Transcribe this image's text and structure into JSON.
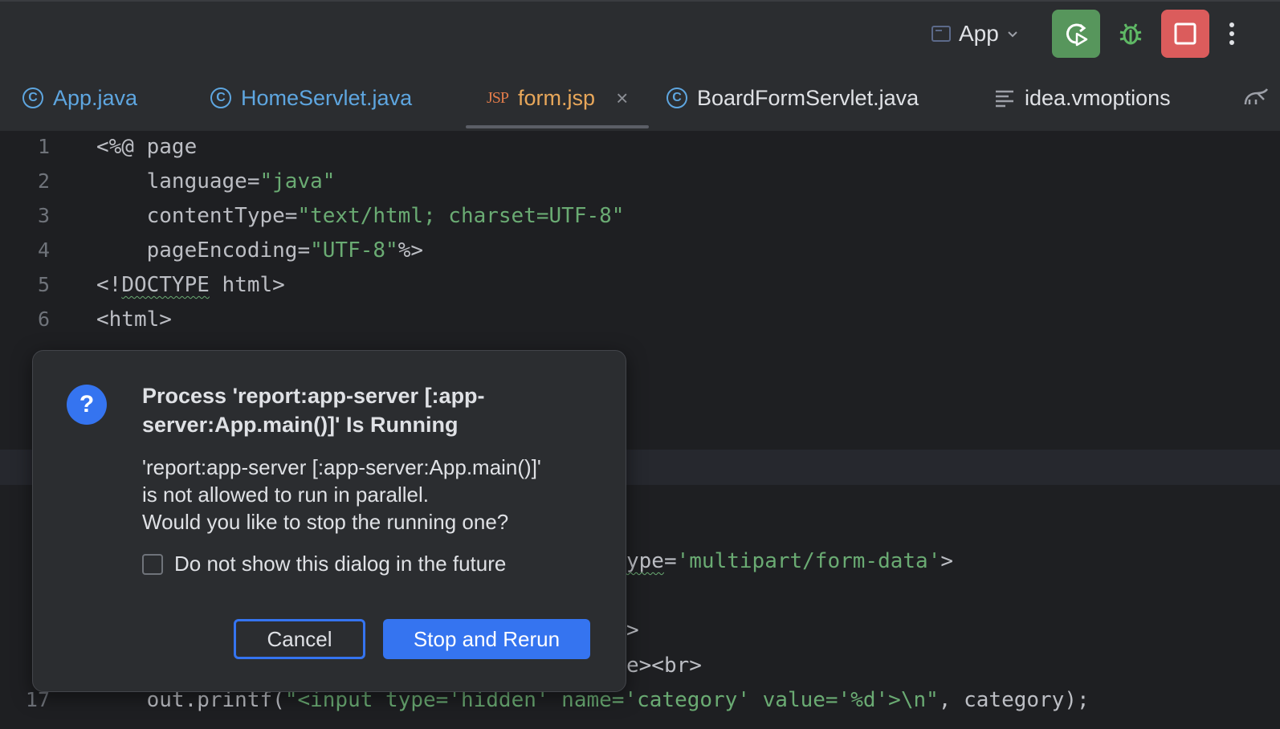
{
  "toolbar": {
    "run_config_label": "App",
    "icons": [
      "config-icon",
      "chevron-down-icon",
      "rerun-icon",
      "debug-bug-icon",
      "stop-icon",
      "more-vertical-icon"
    ],
    "colors": {
      "rerun": "#57965c",
      "stop": "#db5c5c",
      "debug": "#5fb865"
    }
  },
  "tabs": [
    {
      "label": "App.java",
      "icon": "class-icon"
    },
    {
      "label": "HomeServlet.java",
      "icon": "class-icon"
    },
    {
      "label": "form.jsp",
      "icon": "jsp-icon",
      "icon_text": "JSP",
      "active": true
    },
    {
      "label": "BoardFormServlet.java",
      "icon": "class-icon"
    },
    {
      "label": "idea.vmoptions",
      "icon": "text-file-icon"
    }
  ],
  "editor": {
    "lines": [
      {
        "no": "1",
        "pre": "<%@ page"
      },
      {
        "no": "2",
        "pre": "    language=",
        "str": "\"java\""
      },
      {
        "no": "3",
        "pre": "    contentType=",
        "str": "\"text/html; charset=UTF-8\""
      },
      {
        "no": "4",
        "pre": "    pageEncoding=",
        "str": "\"UTF-8\"",
        "post": "%>"
      },
      {
        "no": "5",
        "pre": "<!",
        "squig": "DOCTYPE",
        "post": " html>"
      },
      {
        "no": "6",
        "pre": "<html>"
      }
    ],
    "partial_line_a": {
      "squig": "ype",
      "pre": "=",
      "str": "'multipart/form-data'",
      "post": ">"
    },
    "partial_line_b": ">",
    "partial_line_c": "e><br>",
    "line17": {
      "no": "17",
      "pre": "    out.printf(",
      "str": "\"<input type='hidden' name='category' value='%d'>\\n\"",
      "post": ", category);"
    }
  },
  "dialog": {
    "title": "Process 'report:app-server [:app-server:App.main()]' Is Running",
    "message_lines": [
      "'report:app-server [:app-server:App.main()]'",
      "is not allowed to run in parallel.",
      "Would you like to stop the running one?"
    ],
    "checkbox_label": "Do not show this dialog in the future",
    "cancel_label": "Cancel",
    "primary_label": "Stop and Rerun",
    "icon": "question-icon",
    "icon_glyph": "?",
    "accent": "#3574f0"
  }
}
